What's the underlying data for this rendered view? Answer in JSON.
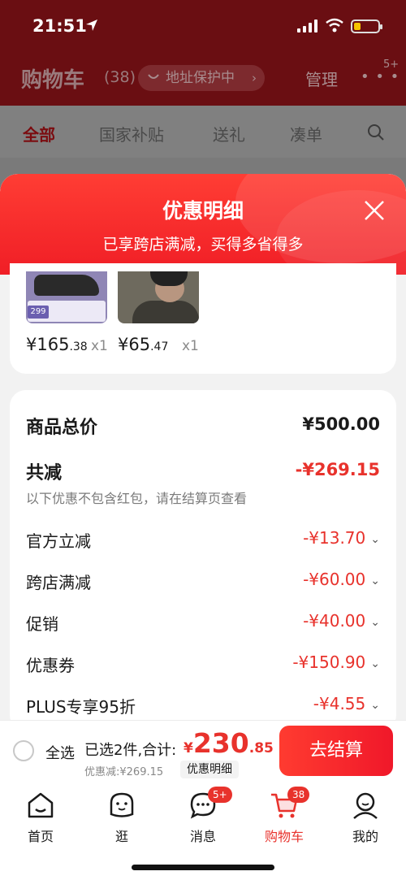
{
  "status_bar": {
    "time": "21:51"
  },
  "cart_header": {
    "title": "购物车",
    "count": "(38)",
    "address_protect": "地址保护中",
    "manage": "管理",
    "more_badge": "5+"
  },
  "cart_tabs": [
    "全部",
    "国家补贴",
    "送礼",
    "凑单"
  ],
  "sheet": {
    "title": "优惠明细",
    "subtitle": "已享跨店满减，买得多省得多"
  },
  "products": [
    {
      "price_int": "¥165",
      "price_dec": ".38",
      "qty": "x1",
      "thumb_tag": "299"
    },
    {
      "price_int": "¥65",
      "price_dec": ".47",
      "qty": "x1"
    }
  ],
  "summary": {
    "total_label": "商品总价",
    "total_value": "¥500.00",
    "reduce_label": "共减",
    "reduce_value": "-¥269.15",
    "note": "以下优惠不包含红包，请在结算页查看",
    "items": [
      {
        "label": "官方立减",
        "value": "-¥13.70"
      },
      {
        "label": "跨店满减",
        "value": "-¥60.00"
      },
      {
        "label": "促销",
        "value": "-¥40.00"
      },
      {
        "label": "优惠券",
        "value": "-¥150.90"
      },
      {
        "label": "PLUS专享95折",
        "value": "-¥4.55"
      }
    ]
  },
  "checkout": {
    "select_all": "全选",
    "selected_info": "已选2件,合计:",
    "price_currency": "¥",
    "price_int": "230",
    "price_dec": ".85",
    "discount_note": "优惠减:¥269.15",
    "detail_tag": "优惠明细",
    "button": "去结算"
  },
  "tab_bar": {
    "items": [
      {
        "label": "首页"
      },
      {
        "label": "逛"
      },
      {
        "label": "消息",
        "badge": "5+"
      },
      {
        "label": "购物车",
        "badge": "38"
      },
      {
        "label": "我的"
      }
    ]
  },
  "colors": {
    "accent": "#e8322c",
    "header_dim": "#6a0e12"
  }
}
